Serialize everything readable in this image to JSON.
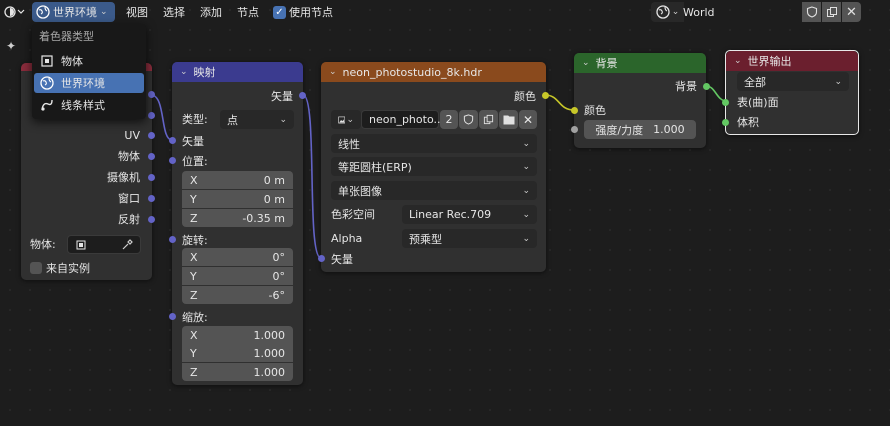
{
  "header": {
    "shader_type_label": "世界环境",
    "menus": [
      "视图",
      "选择",
      "添加",
      "节点"
    ],
    "use_nodes_label": "使用节点",
    "world_name": "World"
  },
  "popup": {
    "title": "着色器类型",
    "items": [
      "物体",
      "世界环境",
      "线条样式"
    ],
    "selected": "世界环境"
  },
  "texcoord_node": {
    "outputs": [
      "UV",
      "物体",
      "摄像机",
      "窗口",
      "反射"
    ],
    "object_label": "物体:",
    "from_instancer_label": "来自实例"
  },
  "mapping_node": {
    "title": "映射",
    "output_vector": "矢量",
    "type_label": "类型:",
    "type_value": "点",
    "vector_label": "矢量",
    "location_label": "位置:",
    "location": [
      {
        "axis": "X",
        "value": "0 m"
      },
      {
        "axis": "Y",
        "value": "0 m"
      },
      {
        "axis": "Z",
        "value": "-0.35 m"
      }
    ],
    "rotation_label": "旋转:",
    "rotation": [
      {
        "axis": "X",
        "value": "0°"
      },
      {
        "axis": "Y",
        "value": "0°"
      },
      {
        "axis": "Z",
        "value": "-6°"
      }
    ],
    "scale_label": "缩放:",
    "scale": [
      {
        "axis": "X",
        "value": "1.000"
      },
      {
        "axis": "Y",
        "value": "1.000"
      },
      {
        "axis": "Z",
        "value": "1.000"
      }
    ]
  },
  "env_node": {
    "title": "neon_photostudio_8k.hdr",
    "output_color": "颜色",
    "image_name": "neon_photo...",
    "user_count": "2",
    "interpolation": "线性",
    "projection": "等距圆柱(ERP)",
    "source": "单张图像",
    "colorspace_label": "色彩空间",
    "colorspace_value": "Linear Rec.709",
    "alpha_label": "Alpha",
    "alpha_value": "预乘型",
    "input_vector": "矢量"
  },
  "background_node": {
    "title": "背景",
    "output": "背景",
    "color_label": "颜色",
    "strength_label": "强度/力度",
    "strength_value": "1.000"
  },
  "output_node": {
    "title": "世界输出",
    "target": "全部",
    "surface_label": "表(曲)面",
    "volume_label": "体积"
  },
  "colors": {
    "accent": "#4772b3",
    "mapping_header": "#3b3b8f",
    "texture_header": "#8a4a1d",
    "shader_header": "#2b652b",
    "output_header": "#6b1f2e",
    "socket_vector": "#6363c7",
    "socket_color": "#c7c729",
    "socket_shader": "#63c763"
  }
}
